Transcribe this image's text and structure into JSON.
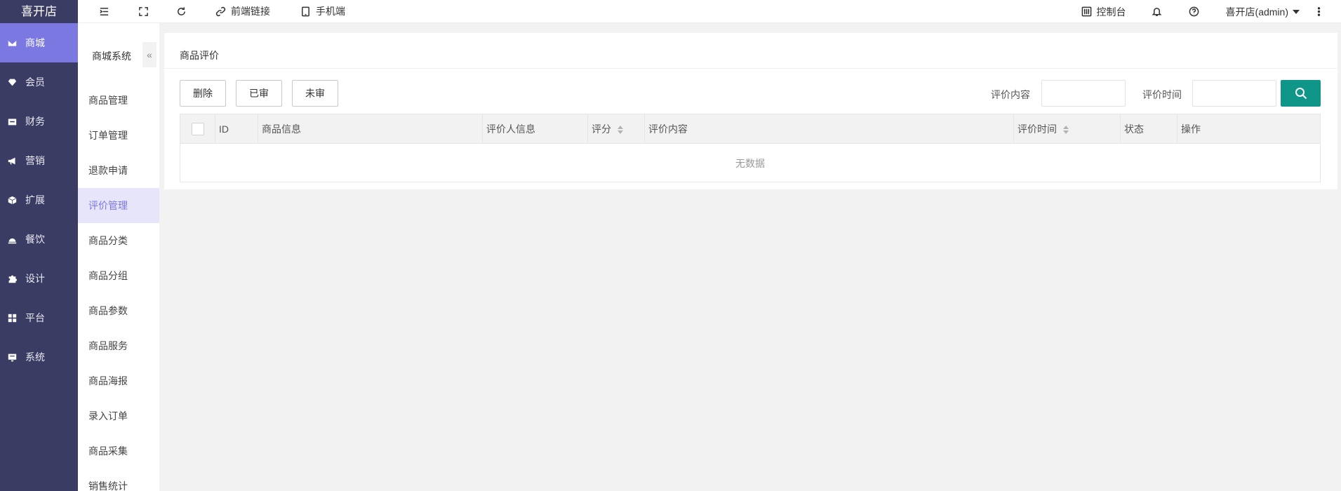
{
  "app": {
    "logo": "喜开店"
  },
  "sidebar": {
    "items": [
      {
        "label": "商城",
        "icon": "mail-icon",
        "active": true
      },
      {
        "label": "会员",
        "icon": "gem-icon"
      },
      {
        "label": "财务",
        "icon": "wallet-icon"
      },
      {
        "label": "营销",
        "icon": "megaphone-icon"
      },
      {
        "label": "扩展",
        "icon": "box-icon"
      },
      {
        "label": "餐饮",
        "icon": "dish-icon"
      },
      {
        "label": "设计",
        "icon": "puzzle-icon"
      },
      {
        "label": "平台",
        "icon": "grid-icon"
      },
      {
        "label": "系统",
        "icon": "monitor-icon"
      }
    ]
  },
  "subbar": {
    "title": "商城系统",
    "collapse": "«",
    "items": [
      {
        "label": "商品管理"
      },
      {
        "label": "订单管理"
      },
      {
        "label": "退款申请"
      },
      {
        "label": "评价管理",
        "active": true
      },
      {
        "label": "商品分类"
      },
      {
        "label": "商品分组"
      },
      {
        "label": "商品参数"
      },
      {
        "label": "商品服务"
      },
      {
        "label": "商品海报"
      },
      {
        "label": "录入订单"
      },
      {
        "label": "商品采集"
      },
      {
        "label": "销售统计"
      }
    ]
  },
  "header": {
    "frontend_link": "前端链接",
    "mobile": "手机端",
    "console": "控制台",
    "user": "喜开店(admin)"
  },
  "main": {
    "title": "商品评价",
    "buttons": {
      "delete": "删除",
      "reviewed": "已审",
      "unreviewed": "未审"
    },
    "filters": {
      "content_label": "评价内容",
      "time_label": "评价时间"
    },
    "table": {
      "columns": {
        "id": "ID",
        "product": "商品信息",
        "reviewer": "评价人信息",
        "score": "评分",
        "content": "评价内容",
        "time": "评价时间",
        "status": "状态",
        "action": "操作"
      },
      "empty": "无数据"
    }
  },
  "colors": {
    "sidebar": "#3a3c64",
    "accent": "#7b78e2",
    "search": "#0f9688"
  }
}
